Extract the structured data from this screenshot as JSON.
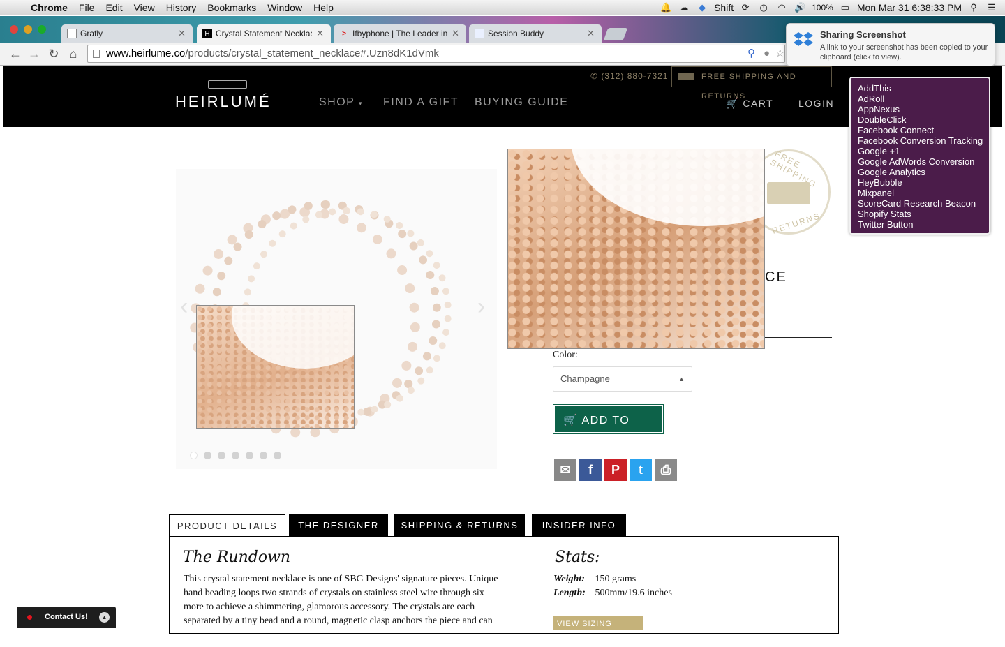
{
  "os_menubar": {
    "app": "Chrome",
    "menus": [
      "File",
      "Edit",
      "View",
      "History",
      "Bookmarks",
      "Window",
      "Help"
    ],
    "status": {
      "keyboard": "Shift",
      "battery": "100%",
      "clock": "Mon Mar 31  6:38:33 PM"
    }
  },
  "browser": {
    "tabs": [
      {
        "title": "Grafly",
        "active": false
      },
      {
        "title": "Crystal Statement Necklace",
        "active": true
      },
      {
        "title": "Ifbyphone | The Leader in",
        "active": false
      },
      {
        "title": "Session Buddy",
        "active": false
      }
    ],
    "url": {
      "domain": "www.heirlume.co",
      "path": "/products/crystal_statement_necklace#.Uzn8dK1dVmk"
    }
  },
  "notification": {
    "title": "Sharing Screenshot",
    "body": "A link to your screenshot has been copied to your clipboard (click to view)."
  },
  "trackers": [
    "AddThis",
    "AdRoll",
    "AppNexus",
    "DoubleClick",
    "Facebook Connect",
    "Facebook Conversion Tracking",
    "Google +1",
    "Google AdWords Conversion",
    "Google Analytics",
    "HeyBubble",
    "Mixpanel",
    "ScoreCard Research Beacon",
    "Shopify Stats",
    "Twitter Button"
  ],
  "site": {
    "logo": "HEIRLUMÉ",
    "nav": {
      "shop": "SHOP",
      "gift": "FIND A GIFT",
      "guide": "BUYING GUIDE"
    },
    "phone": "(312) 880-7321",
    "shipping_banner": "FREE SHIPPING AND RETURNS",
    "cart": "CART",
    "login": "LOGIN"
  },
  "product": {
    "title_visible": "CE",
    "seal_top": "FREE SHIPPING",
    "seal_bottom": "RETURNS",
    "color_label": "Color:",
    "color_value": "Champagne",
    "add_to_cart": "ADD TO CART",
    "carousel_dots": 7,
    "carousel_active": 0
  },
  "tabs": [
    "PRODUCT DETAILS",
    "THE DESIGNER",
    "SHIPPING & RETURNS",
    "INSIDER INFO"
  ],
  "details": {
    "rundown_heading": "The Rundown",
    "rundown_text": "This crystal statement necklace is one of SBG Designs' signature pieces. Unique hand beading loops two strands of crystals on stainless steel wire through six more to achieve a shimmering, glamorous accessory. The crystals are each separated by a tiny bead and a round, magnetic clasp anchors the piece and can",
    "stats_heading": "Stats:",
    "weight_label": "Weight:",
    "weight_value": "150 grams",
    "length_label": "Length:",
    "length_value": "500mm/19.6 inches",
    "sizing_chart": "VIEW SIZING CHART"
  },
  "contact_widget": "Contact Us!"
}
